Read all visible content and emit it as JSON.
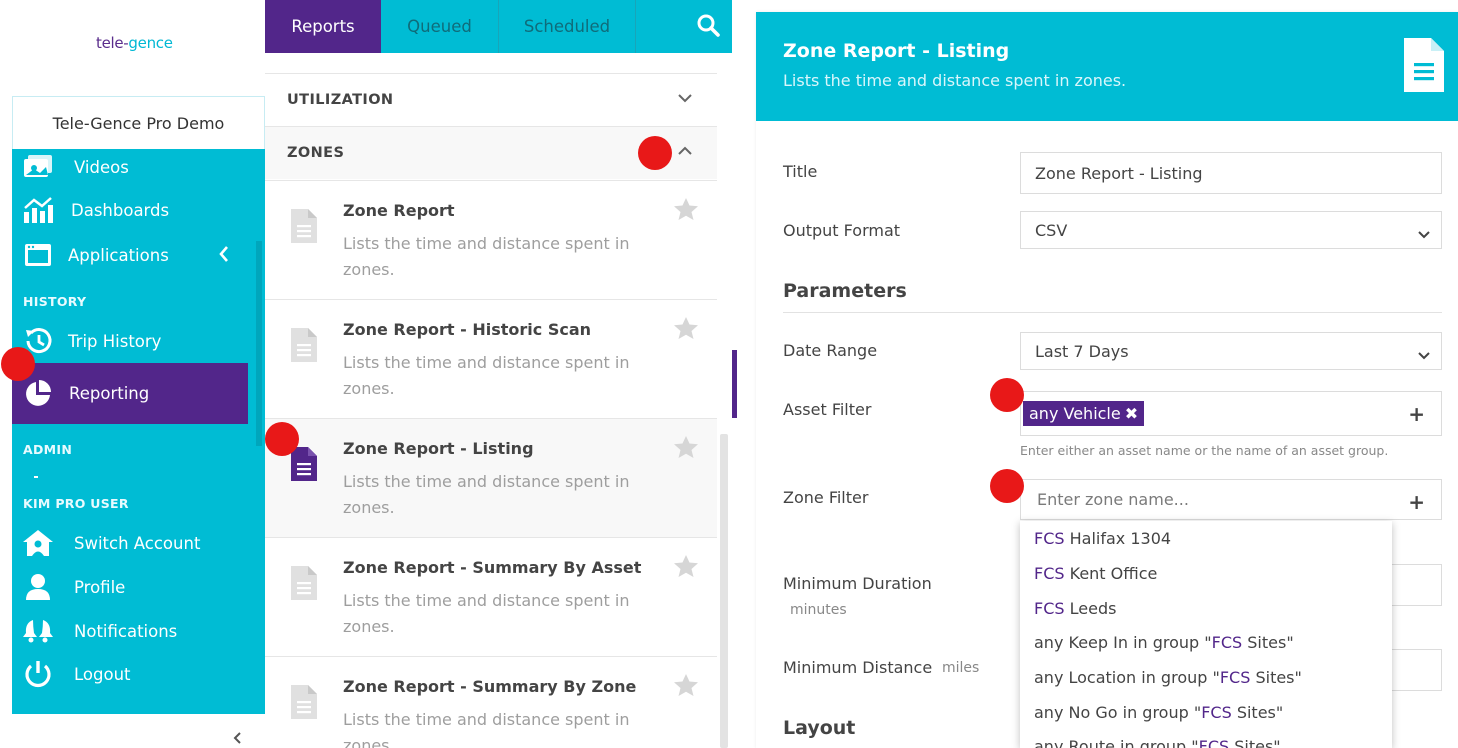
{
  "sidebar": {
    "logo": {
      "part1": "tele-",
      "part2": "gence"
    },
    "account_name": "Tele-Gence Pro Demo",
    "items_top": [
      {
        "label": "Videos",
        "icon": "videos-icon"
      },
      {
        "label": "Dashboards",
        "icon": "dashboards-icon"
      },
      {
        "label": "Applications",
        "icon": "applications-icon"
      }
    ],
    "section_history": "HISTORY",
    "trip_history": "Trip History",
    "reporting": "Reporting",
    "section_admin": "ADMIN",
    "section_user": "KIM PRO USER",
    "user_items": [
      {
        "label": "Switch Account",
        "icon": "switch-account-icon"
      },
      {
        "label": "Profile",
        "icon": "profile-icon"
      },
      {
        "label": "Notifications",
        "icon": "notifications-icon"
      },
      {
        "label": "Logout",
        "icon": "logout-icon"
      }
    ],
    "collapse_glyph": "‹",
    "colors": {
      "teal": "#00bcd4",
      "purple": "#52268a"
    }
  },
  "middle": {
    "tabs": [
      {
        "label": "Reports",
        "active": true
      },
      {
        "label": "Queued",
        "active": false
      },
      {
        "label": "Scheduled",
        "active": false
      }
    ],
    "categories": [
      {
        "label": "UTILIZATION",
        "state": "collapsed"
      },
      {
        "label": "ZONES",
        "state": "expanded"
      }
    ],
    "reports": [
      {
        "name": "Zone Report",
        "desc": "Lists the time and distance spent in zones."
      },
      {
        "name": "Zone Report - Historic Scan",
        "desc": "Lists the time and distance spent in zones."
      },
      {
        "name": "Zone Report - Listing",
        "desc": "Lists the time and distance spent in zones.",
        "selected": true
      },
      {
        "name": "Zone Report - Summary By Asset",
        "desc": "Lists the time and distance spent in zones."
      },
      {
        "name": "Zone Report - Summary By Zone",
        "desc": "Lists the time and distance spent in zones."
      }
    ]
  },
  "right": {
    "header_title": "Zone Report - Listing",
    "header_subtitle": "Lists the time and distance spent in zones.",
    "title_label": "Title",
    "title_value": "Zone Report - Listing",
    "output_label": "Output Format",
    "output_value": "CSV",
    "parameters_heading": "Parameters",
    "date_range_label": "Date Range",
    "date_range_value": "Last 7 Days",
    "asset_filter_label": "Asset Filter",
    "asset_chip": "any Vehicle",
    "asset_help": "Enter either an asset name or the name of an asset group.",
    "zone_filter_label": "Zone Filter",
    "zone_placeholder": "Enter zone name...",
    "min_duration_label": "Minimum Duration",
    "min_duration_unit": "minutes",
    "min_distance_label": "Minimum Distance",
    "min_distance_unit": "miles",
    "layout_heading": "Layout",
    "dropdown": [
      {
        "pre": "",
        "hl": "FCS",
        "post": " Halifax 1304"
      },
      {
        "pre": "",
        "hl": "FCS",
        "post": " Kent Office"
      },
      {
        "pre": "",
        "hl": "FCS",
        "post": " Leeds"
      },
      {
        "pre": "any Keep In in group \"",
        "hl": "FCS",
        "post": " Sites\""
      },
      {
        "pre": "any Location in group \"",
        "hl": "FCS",
        "post": " Sites\""
      },
      {
        "pre": "any No Go in group \"",
        "hl": "FCS",
        "post": " Sites\""
      },
      {
        "pre": "any Route in group \"",
        "hl": "FCS",
        "post": " Sites\""
      }
    ]
  }
}
